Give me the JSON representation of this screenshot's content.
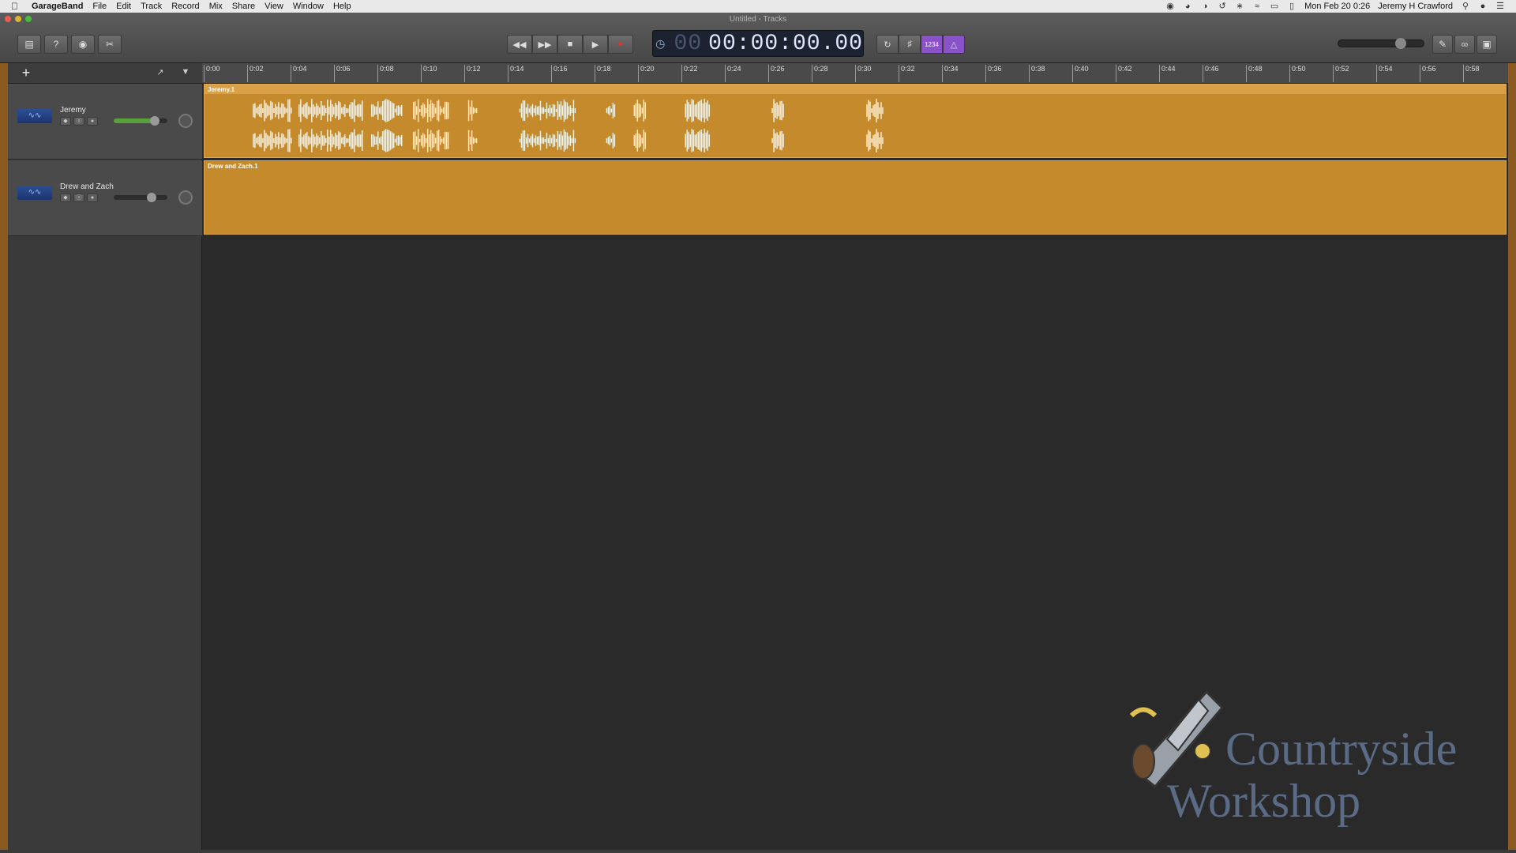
{
  "menubar": {
    "apple": "",
    "app_name": "GarageBand",
    "menus": [
      "File",
      "Edit",
      "Track",
      "Record",
      "Mix",
      "Share",
      "View",
      "Window",
      "Help"
    ],
    "clock": "Mon Feb 20  0:26",
    "user": "Jeremy H Crawford"
  },
  "window": {
    "title": "Untitled - Tracks"
  },
  "transport": {
    "time_dim": "00",
    "time": "00:00:00.00",
    "count_in": "1234"
  },
  "ruler": {
    "ticks": [
      "0:00",
      "0:02",
      "0:04",
      "0:06",
      "0:08",
      "0:10",
      "0:12",
      "0:14",
      "0:16",
      "0:18",
      "0:20",
      "0:22",
      "0:24",
      "0:26",
      "0:28",
      "0:30",
      "0:32",
      "0:34",
      "0:36",
      "0:38",
      "0:40",
      "0:42",
      "0:44",
      "0:46",
      "0:48",
      "0:50",
      "0:52",
      "0:54",
      "0:56",
      "0:58"
    ]
  },
  "tracks": [
    {
      "name": "Jeremy",
      "region": "Jeremy.1",
      "volume": 0.8
    },
    {
      "name": "Drew and Zach",
      "region": "Drew and Zach.1",
      "volume": 0.7
    }
  ],
  "logo": {
    "line1": "Countryside",
    "line2": "Workshop"
  },
  "colors": {
    "region": "#c48a2c",
    "accent_purple": "#8a52c8",
    "record": "#e03030"
  }
}
